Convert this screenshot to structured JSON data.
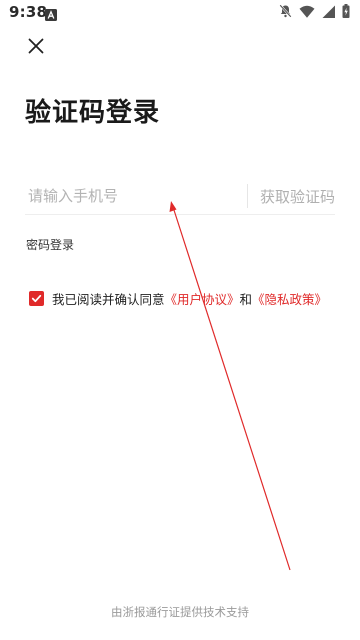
{
  "status_bar": {
    "time": "9:38",
    "icons": [
      "android-app-icon",
      "notifications-off-icon",
      "wifi-icon",
      "signal-icon",
      "battery-charging-icon"
    ]
  },
  "header": {
    "close_icon": "close-icon"
  },
  "main": {
    "title": "验证码登录",
    "phone_placeholder": "请输入手机号",
    "get_code_label": "获取验证码",
    "password_login_label": "密码登录",
    "agreement": {
      "checked": true,
      "prefix": "我已阅读并确认同意",
      "user_agreement": "《用户协议》",
      "conjunction": "和",
      "privacy_policy": "《隐私政策》"
    }
  },
  "footer": {
    "credit": "由浙报通行证提供技术支持"
  },
  "colors": {
    "accent": "#e02a2a",
    "placeholder": "#b3b3b3",
    "title": "#1a1a1a"
  }
}
